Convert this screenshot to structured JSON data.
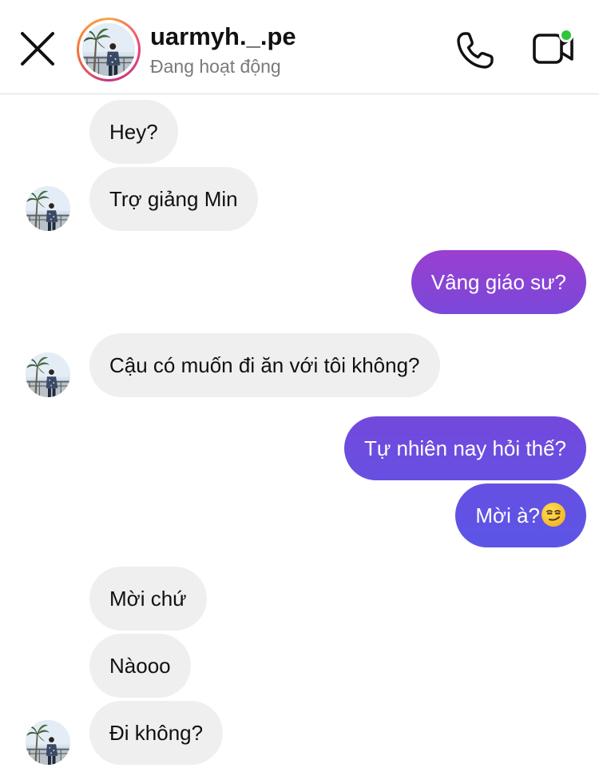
{
  "header": {
    "close_icon": "close-icon",
    "contact_name": "uarmyh._.pe",
    "contact_status": "Đang hoạt động",
    "call_icon": "phone-icon",
    "video_icon": "video-camera-icon",
    "online_indicator_color": "#2fc53a",
    "avatar_ring_colors": [
      "#f9a44a",
      "#e9407a",
      "#c13584"
    ]
  },
  "messages": [
    {
      "sender": "them",
      "text": "Hey?"
    },
    {
      "sender": "them",
      "text": "Trợ giảng Min"
    },
    {
      "sender": "me",
      "text": "Vâng giáo sư?"
    },
    {
      "sender": "them",
      "text": "Cậu có muốn đi ăn với tôi không?"
    },
    {
      "sender": "me",
      "text": "Tự nhiên nay hỏi thế?"
    },
    {
      "sender": "me",
      "text": "Mời à?",
      "emoji": "smirking-face"
    },
    {
      "sender": "them",
      "text": "Mời chứ"
    },
    {
      "sender": "them",
      "text": "Nàooo"
    },
    {
      "sender": "them",
      "text": "Đi không?"
    }
  ],
  "colors": {
    "incoming_bubble": "#efefef",
    "outgoing_gradient_top": "#9a3fd0",
    "outgoing_gradient_bottom": "#5b55e6",
    "status_text": "#7a7a7a"
  }
}
